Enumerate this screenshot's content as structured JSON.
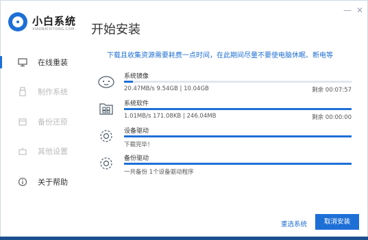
{
  "window": {
    "brand_name": "小白系统",
    "brand_sub": "XIAOBAIXITONG.COM",
    "page_title": "开始安装",
    "min_glyph": "—",
    "close_glyph": "✕"
  },
  "sidebar": {
    "items": [
      {
        "label": "在线重装",
        "icon": "monitor-icon",
        "state": "active"
      },
      {
        "label": "制作系统",
        "icon": "usb-icon",
        "state": "disabled"
      },
      {
        "label": "备份还原",
        "icon": "backup-icon",
        "state": "disabled"
      },
      {
        "label": "其他设置",
        "icon": "settings-icon",
        "state": "disabled"
      },
      {
        "label": "关于帮助",
        "icon": "info-icon",
        "state": "normal"
      }
    ]
  },
  "notice": "下载且收集资源需要耗费一点时间，在此期间尽量不要使电脑休眠、断电等",
  "tasks": [
    {
      "name": "系统镜像",
      "icon": "cloud-face-icon",
      "progress": 0.04,
      "stats": "20.47MB/s 9.54GB | 10.04GB",
      "remain": "剩余 00:07:57"
    },
    {
      "name": "系统软件",
      "icon": "apps-icon",
      "progress": 1.0,
      "stats": "1.01MB/s 171.08KB | 246.04MB",
      "remain": "剩余 00:00:00"
    },
    {
      "name": "设备驱动",
      "icon": "gear-icon",
      "progress": 1.0,
      "stats": "下载完毕！",
      "remain": ""
    },
    {
      "name": "备份驱动",
      "icon": "gear-icon",
      "progress": 1.0,
      "stats": "一共备份 1个设备驱动程序",
      "remain": ""
    }
  ],
  "footer": {
    "reselect_label": "重选系统",
    "cancel_label": "取消安装"
  },
  "colors": {
    "accent": "#1d6fd6",
    "track": "#e1e7ef"
  }
}
